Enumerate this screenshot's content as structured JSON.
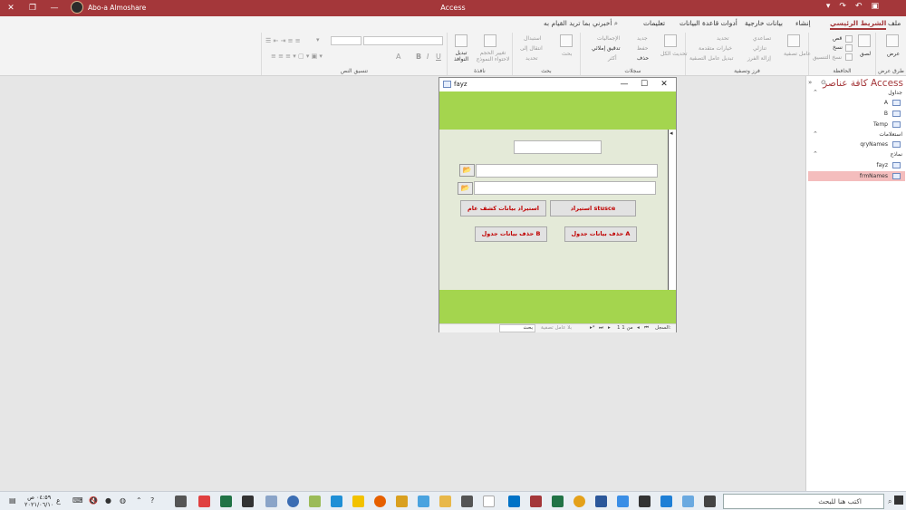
{
  "window": {
    "app_title": "Access",
    "user_name": "Abo-a Almoshare"
  },
  "ribbon_tabs": {
    "file": "ملف",
    "home": "الشريط الرئيسي",
    "create": "إنشاء",
    "external_data": "بيانات خارجية",
    "db_tools": "أدوات قاعدة البيانات",
    "help": "تعليمات",
    "tell_me": "أخبرني بما تريد القيام به"
  },
  "ribbon": {
    "views": {
      "label": "طرق عرض",
      "view": "عرض"
    },
    "clipboard": {
      "label": "الحافظة",
      "paste": "لصق",
      "cut": "قص",
      "copy": "نسخ",
      "format_painter": "نسخ التنسيق"
    },
    "sort_filter": {
      "label": "فرز وتصفية",
      "filter": "عامل تصفية",
      "ascending": "تصاعدي",
      "descending": "تنازلي",
      "remove_sort": "إزالة الفرز",
      "selection": "تحديد",
      "advanced": "خيارات متقدمة",
      "toggle_filter": "تبديل عامل التصفية"
    },
    "records": {
      "label": "سجلات",
      "refresh": "تحديث الكل",
      "new": "جديد",
      "save": "حفظ",
      "delete": "حذف",
      "totals": "الإجماليات",
      "spelling": "تدقيق إملائي",
      "more": "أكثر"
    },
    "find": {
      "label": "بحث",
      "find": "بحث",
      "replace": "استبدال",
      "goto": "انتقال إلى",
      "select": "تحديد"
    },
    "window": {
      "label": "نافذة",
      "size_to_fit": "تغيير الحجم لاحتواء النموذج",
      "switch_windows": "تبديل النوافذ"
    },
    "text_formatting": {
      "label": "تنسيق النص"
    }
  },
  "nav_pane": {
    "title": "كافة عناصر Access",
    "groups": [
      {
        "label": "جداول",
        "items": [
          "A",
          "B",
          "Temp"
        ]
      },
      {
        "label": "استعلامات",
        "items": [
          "qryNames"
        ]
      },
      {
        "label": "نماذج",
        "items": [
          "fayz",
          "frmNames"
        ]
      }
    ],
    "selected": "frmNames"
  },
  "form": {
    "title": "fayz",
    "buttons": {
      "import_general": "استيراد بيانات كشف عام",
      "import_stusce": "استيراد stusce",
      "delete_a": "حذف بيانات جدول A",
      "delete_b": "حذف بيانات جدول B"
    },
    "folder_glyph": "📂",
    "record_nav": {
      "label": "السجل:",
      "position": "1 من 1",
      "no_filter": "بلا عامل تصفية",
      "search": "بحث"
    }
  },
  "taskbar": {
    "search_placeholder": "اكتب هنا للبحث",
    "time": "٠٤:٥٩ ص",
    "date": "٢٠٢١/٠٦/١٠",
    "lang": "ع"
  },
  "colors": {
    "access_red": "#a4373a",
    "form_green": "#a4d54e",
    "button_text": "#c00000"
  }
}
